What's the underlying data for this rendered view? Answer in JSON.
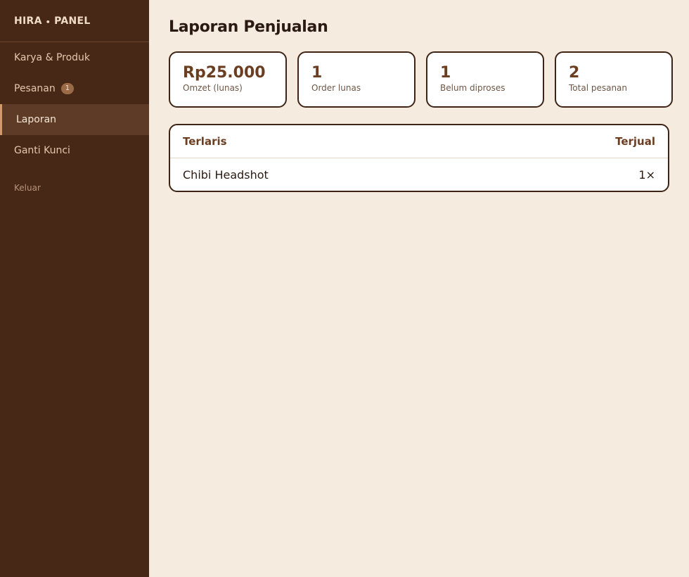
{
  "brand": {
    "left": "HIRA",
    "dot": "•",
    "right": "PANEL"
  },
  "sidebar": {
    "items": [
      {
        "label": "Karya & Produk"
      },
      {
        "label": "Pesanan",
        "badge": "1"
      },
      {
        "label": "Laporan"
      },
      {
        "label": "Ganti Kunci"
      }
    ],
    "active": "Laporan",
    "logout": "Keluar"
  },
  "main": {
    "title": "Laporan Penjualan",
    "stats": [
      {
        "value": "Rp25.000",
        "label": "Omzet (lunas)"
      },
      {
        "value": "1",
        "label": "Order lunas"
      },
      {
        "value": "1",
        "label": "Belum diproses"
      },
      {
        "value": "2",
        "label": "Total pesanan"
      }
    ],
    "table": {
      "headers": {
        "product": "Terlaris",
        "sold": "Terjual"
      },
      "rows": [
        {
          "product": "Chibi Headshot",
          "sold": "1×"
        }
      ]
    }
  },
  "colors": {
    "sidebar_bg": "#472716",
    "page_bg": "#f5ebde",
    "accent": "#6b3e22",
    "active_item_bg": "#5e3b27"
  }
}
